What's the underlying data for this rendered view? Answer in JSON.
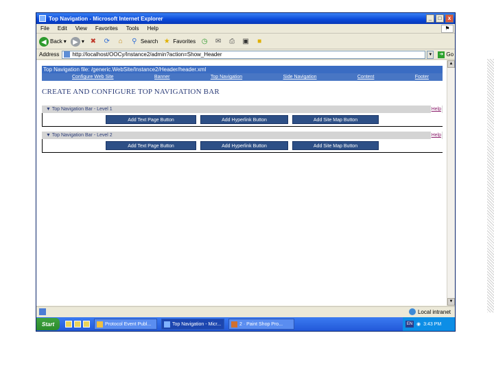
{
  "window": {
    "title": "Top Navigation - Microsoft Internet Explorer",
    "controls": [
      "_",
      "□",
      "x"
    ]
  },
  "menu": [
    "File",
    "Edit",
    "View",
    "Favorites",
    "Tools",
    "Help"
  ],
  "toolbar": {
    "back": "Back",
    "search": "Search",
    "favorites": "Favorites"
  },
  "address": {
    "label": "Address",
    "url": "http://localhost/OOCy/Instance2/admin?action=Show_Header",
    "go": "Go"
  },
  "page": {
    "file_path": "Top Navigation file: /generic.WebSite/Instance2/Header/header.xml",
    "nav": [
      "Configure Web Site",
      "Banner",
      "Top Navigation",
      "Side Navigation",
      "Content",
      "Footer"
    ],
    "title": "CREATE AND CONFIGURE TOP NAVIGATION BAR",
    "levels": [
      {
        "label": "▼ Top Navigation Bar - Level 1",
        "help": "Help",
        "buttons": [
          "Add Text Page Button",
          "Add Hyperlink Button",
          "Add Site Map Button"
        ]
      },
      {
        "label": "▼ Top Navigation Bar - Level 2",
        "help": "Help",
        "buttons": [
          "Add Text Page Button",
          "Add Hyperlink Button",
          "Add Site Map Button"
        ]
      }
    ]
  },
  "status": {
    "zone": "Local intranet"
  },
  "taskbar": {
    "start": "Start",
    "tasks": [
      "Protocol Event Publ...",
      "Top Navigation - Micr...",
      "2 · Paint Shop Pro..."
    ],
    "tray_lang": "EN",
    "clock": "3:43 PM"
  },
  "colors": {
    "title_bar": "#0a48d8",
    "nav_bar": "#4876c4",
    "button_bg": "#2d4f86",
    "heading": "#2b3c78"
  }
}
